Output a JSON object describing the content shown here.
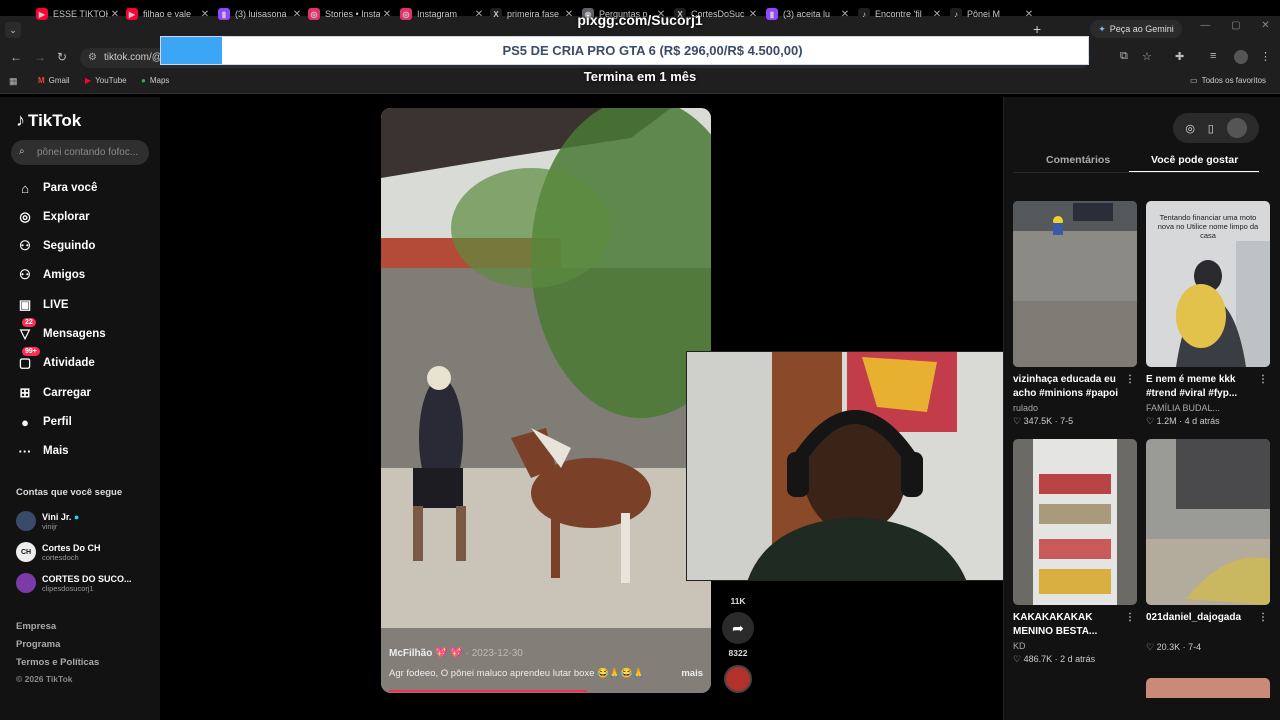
{
  "browser": {
    "tabs": [
      {
        "title": "ESSE TIKTOK",
        "fav": "▶",
        "favColor": "#ff0033"
      },
      {
        "title": "filhao e vale",
        "fav": "▶",
        "favColor": "#ff0033"
      },
      {
        "title": "(3) luisasona",
        "fav": "▮",
        "favColor": "#9146ff"
      },
      {
        "title": "Stories • Insta",
        "fav": "◎",
        "favColor": "#e1306c"
      },
      {
        "title": "Instagram",
        "fav": "◎",
        "favColor": "#e1306c"
      },
      {
        "title": "primeira fase",
        "fav": "X",
        "favColor": "#1f1f1f"
      },
      {
        "title": "Perguntas p",
        "fav": "◉",
        "favColor": "#5f6368"
      },
      {
        "title": "CortesDoSuc",
        "fav": "X",
        "favColor": "#1f1f1f"
      },
      {
        "title": "(3) aceita lu",
        "fav": "▮",
        "favColor": "#9146ff"
      },
      {
        "title": "Encontre 'fil",
        "fav": "♪",
        "favColor": "#1f1f1f"
      },
      {
        "title": "Pônei M",
        "fav": "♪",
        "favColor": "#1f1f1f"
      }
    ],
    "new_tab": "+",
    "gemini": "Peça ao Gemini",
    "url": "tiktok.com/@",
    "bookmarks": [
      "Gmail",
      "YouTube",
      "Maps"
    ],
    "all_bookmarks": "Todos os favoritos"
  },
  "stream_overlay": {
    "site": "pixgg.com/Sucorj1",
    "goal": "PS5 DE CRIA PRO GTA 6 (R$ 296,00/R$ 4.500,00)",
    "goal_progress": 0.0658,
    "ends": "Termina em 1 mês"
  },
  "sidebar": {
    "logo": "TikTok",
    "search_placeholder": "pônei contando fofoc...",
    "nav": [
      {
        "label": "Para você",
        "icon": "⌂"
      },
      {
        "label": "Explorar",
        "icon": "◎"
      },
      {
        "label": "Seguindo",
        "icon": "⚇"
      },
      {
        "label": "Amigos",
        "icon": "⚇"
      },
      {
        "label": "LIVE",
        "icon": "▣"
      },
      {
        "label": "Mensagens",
        "icon": "▽",
        "badge": "22"
      },
      {
        "label": "Atividade",
        "icon": "▢",
        "badge": "99+"
      },
      {
        "label": "Carregar",
        "icon": "⊞"
      },
      {
        "label": "Perfil",
        "icon": "●"
      },
      {
        "label": "Mais",
        "icon": "···"
      }
    ],
    "following_header": "Contas que você segue",
    "accounts": [
      {
        "name": "Vini Jr.",
        "handle": "vinijr",
        "verified": true,
        "avatar": "",
        "avColor": "#3a4a6a"
      },
      {
        "name": "Cortes Do CH",
        "handle": "cortesdoch",
        "verified": false,
        "avatar": "CH",
        "avColor": "#eeeeee"
      },
      {
        "name": "CORTES DO SUCO...",
        "handle": "clipesdosucorj1",
        "verified": false,
        "avatar": "",
        "avColor": "#7a3aa8"
      }
    ],
    "footer": [
      "Empresa",
      "Programa",
      "Termos e Políticas",
      "© 2026 TikTok"
    ]
  },
  "video": {
    "author": "McFilhão 💖 💖",
    "date": "2023-12-30",
    "caption": "Agr fodeeo, O pônei maluco aprendeu lutar boxe 😂🙏😂🙏",
    "more": "mais",
    "progress": 0.63,
    "actions": [
      {
        "icon": "share-icon",
        "count": "11K"
      },
      {
        "icon": "share-icon",
        "count": "8322"
      }
    ]
  },
  "right_panel": {
    "tabs": [
      "Comentários",
      "Você pode gostar"
    ],
    "active_tab": 1,
    "cards": [
      {
        "title": "vizinhaça educada eu acho #minions #papoi",
        "author": "rulado",
        "likes": "347.5K",
        "time": "7-5",
        "overlay": ""
      },
      {
        "title": "E nem é meme kkk #trend #viral #fyp...",
        "author": "FAMÍLIA BUDAL...",
        "likes": "1.2M",
        "time": "4 d atrás",
        "overlay": "Tentando financiar uma moto nova no Utilice nome limpo da casa"
      },
      {
        "title": "KAKAKAKAKAK MENINO BESTA...",
        "author": "KD",
        "likes": "486.7K",
        "time": "2 d atrás",
        "overlay": ""
      },
      {
        "title": "021daniel_dajogada",
        "author": "",
        "likes": "20.3K",
        "time": "7-4",
        "overlay": ""
      }
    ]
  }
}
